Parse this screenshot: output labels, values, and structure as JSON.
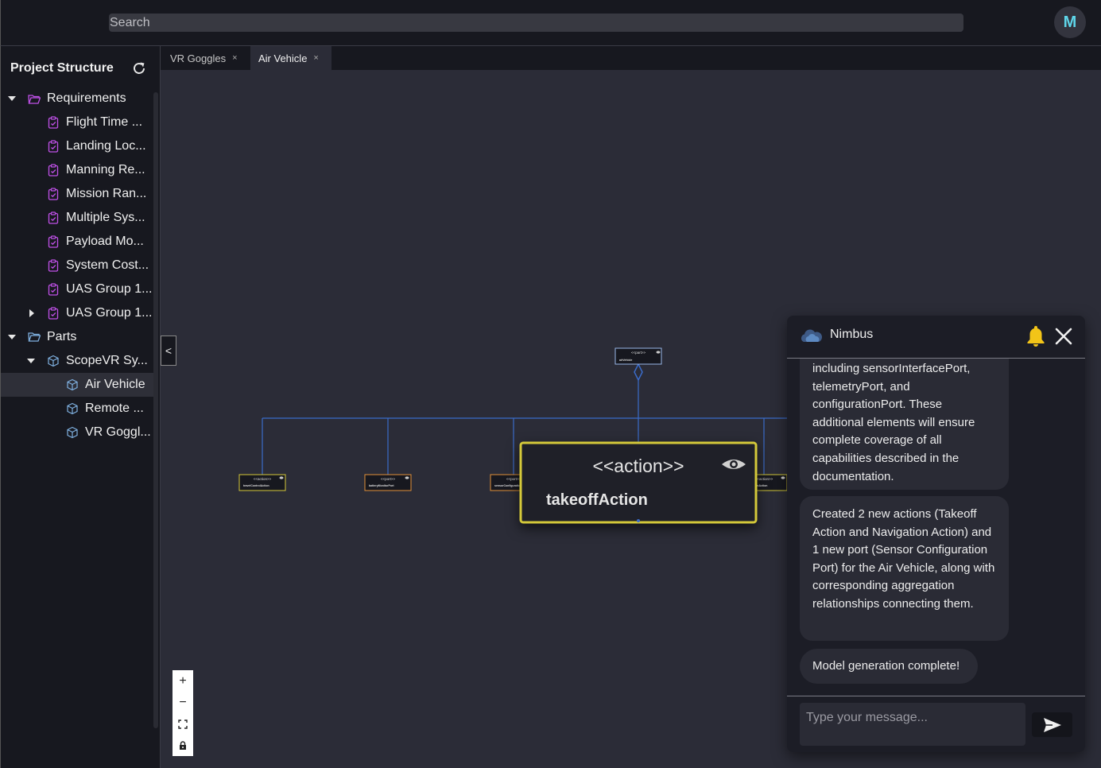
{
  "search": {
    "placeholder": "Search"
  },
  "user": {
    "avatar_initial": "M"
  },
  "sidebar": {
    "title": "Project Structure",
    "items": [
      {
        "label": "Requirements",
        "type": "folder"
      },
      {
        "label": "Flight Time ...",
        "type": "requirement"
      },
      {
        "label": "Landing Loc...",
        "type": "requirement"
      },
      {
        "label": "Manning Re...",
        "type": "requirement"
      },
      {
        "label": "Mission Ran...",
        "type": "requirement"
      },
      {
        "label": "Multiple Sys...",
        "type": "requirement"
      },
      {
        "label": "Payload Mo...",
        "type": "requirement"
      },
      {
        "label": "System Cost...",
        "type": "requirement"
      },
      {
        "label": "UAS Group 1...",
        "type": "requirement"
      },
      {
        "label": "UAS Group 1...",
        "type": "requirement"
      },
      {
        "label": "Parts",
        "type": "folder"
      },
      {
        "label": "ScopeVR Sy...",
        "type": "part"
      },
      {
        "label": "Air Vehicle",
        "type": "part",
        "selected": true
      },
      {
        "label": "Remote ...",
        "type": "part"
      },
      {
        "label": "VR Goggl...",
        "type": "part"
      }
    ]
  },
  "tabs": [
    {
      "label": "VR Goggles",
      "close": "×"
    },
    {
      "label": "Air Vehicle",
      "close": "×",
      "active": true
    }
  ],
  "diagram": {
    "root_node": {
      "stereotype": "<<part>>",
      "name": "airVehicle"
    },
    "small_nodes": [
      {
        "stereotype": "<<action>>",
        "name": "travelControlAction"
      },
      {
        "stereotype": "<<port>>",
        "name": "batteryMonitorPort"
      },
      {
        "stereotype": "<<port>>",
        "name": "sensorConfigurationPort"
      },
      {
        "stereotype": "<<action>>",
        "name": "navigationAction"
      }
    ],
    "focused_node": {
      "stereotype": "<<action>>",
      "name": "takeoffAction"
    }
  },
  "collapse_label": "<",
  "zoom_controls": {
    "zoom_in": "+",
    "zoom_out": "−"
  },
  "chat": {
    "title": "Nimbus",
    "messages": [
      {
        "text": "including sensorInterfacePort, telemetryPort, and configurationPort. These additional elements will ensure complete coverage of all capabilities described in the documentation."
      },
      {
        "text": "Created 2 new actions (Takeoff Action and Navigation Action) and 1 new port (Sensor Configuration Port) for the Air Vehicle, along with corresponding aggregation relationships connecting them."
      },
      {
        "text": "Model generation complete!"
      }
    ],
    "input_placeholder": "Type your message..."
  },
  "colors": {
    "accent_purple": "#c050e8",
    "part_icon_blue": "#7fb0e0",
    "edge_blue": "#3b6bc8",
    "highlight_yellow": "#d4c93a",
    "avatar_text": "#5fd6ea",
    "bell": "#f2c418"
  }
}
